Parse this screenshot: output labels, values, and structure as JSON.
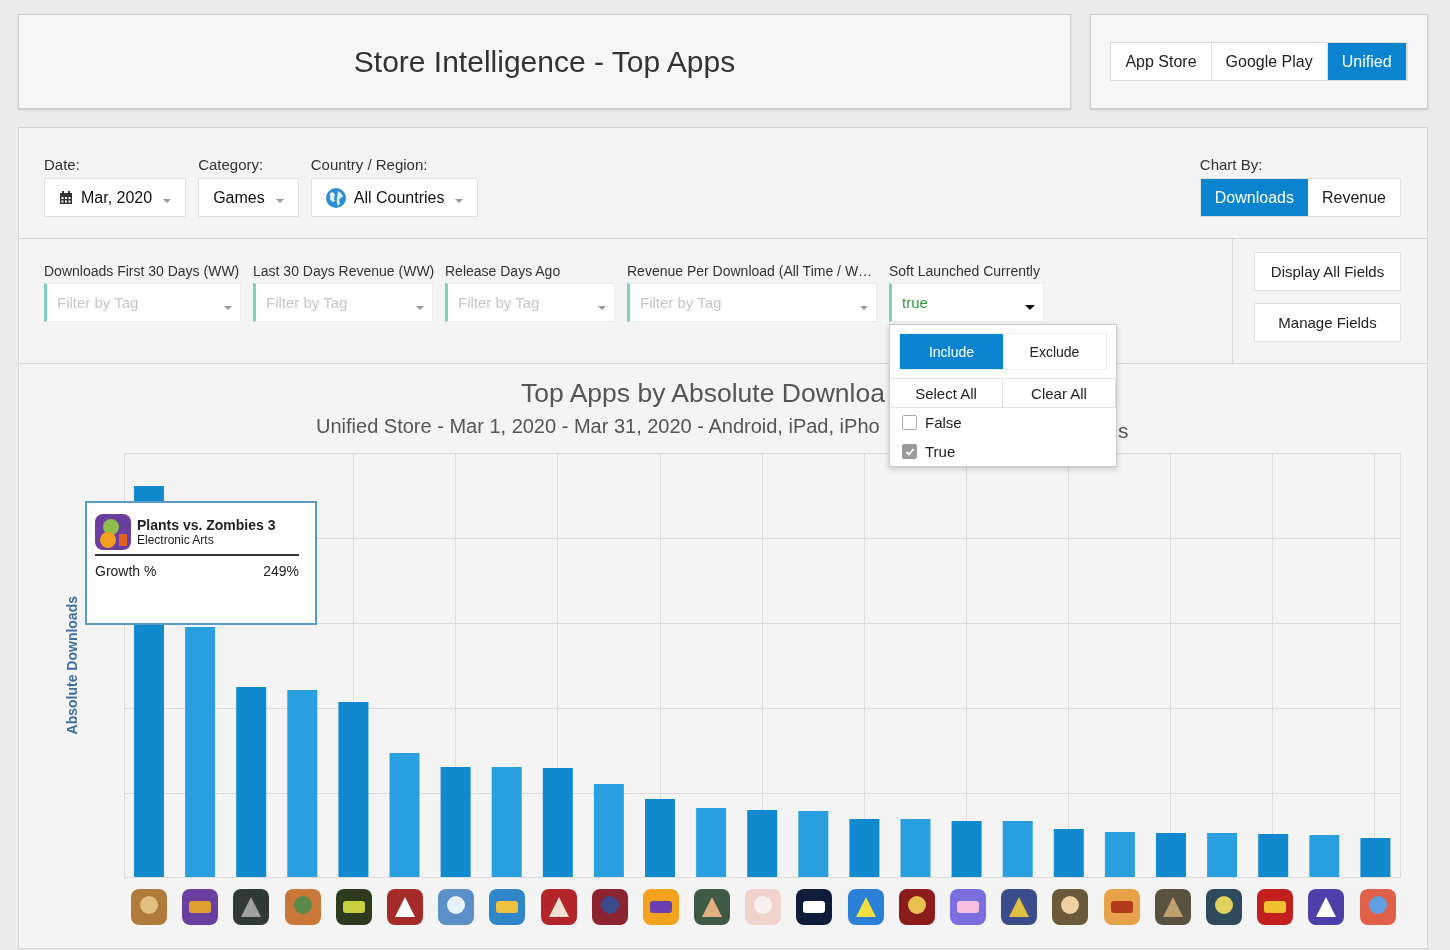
{
  "header": {
    "title": "Store Intelligence - Top Apps"
  },
  "store_tabs": [
    {
      "label": "App Store",
      "selected": false
    },
    {
      "label": "Google Play",
      "selected": false
    },
    {
      "label": "Unified",
      "selected": true
    }
  ],
  "filters": [
    {
      "kind": "date",
      "label": "Date:",
      "value": "Mar, 2020"
    },
    {
      "kind": "plain",
      "label": "Category:",
      "value": "Games"
    },
    {
      "kind": "country",
      "label": "Country / Region:",
      "value": "All Countries"
    }
  ],
  "chart_by": {
    "label": "Chart By:",
    "options": [
      {
        "label": "Downloads",
        "selected": true
      },
      {
        "label": "Revenue",
        "selected": false
      }
    ]
  },
  "field_filters": [
    {
      "label": "Downloads First 30 Days (WW)",
      "placeholder": "Filter by Tag",
      "open": false
    },
    {
      "label": "Last 30 Days Revenue (WW)",
      "placeholder": "Filter by Tag",
      "open": false
    },
    {
      "label": "Release Days Ago",
      "placeholder": "Filter by Tag",
      "open": false
    },
    {
      "label": "Revenue Per Download (All Time / W…",
      "placeholder": "Filter by Tag",
      "open": false
    },
    {
      "label": "Soft Launched Currently",
      "value": "true",
      "open": true
    }
  ],
  "dropdown": {
    "modes": [
      {
        "label": "Include",
        "selected": true
      },
      {
        "label": "Exclude",
        "selected": false
      }
    ],
    "actions": [
      "Select All",
      "Clear All"
    ],
    "options": [
      {
        "label": "False",
        "checked": false
      },
      {
        "label": "True",
        "checked": true
      }
    ]
  },
  "side_buttons": [
    "Display All Fields",
    "Manage Fields"
  ],
  "chart": {
    "title": "Top Apps by Absolute Downloa",
    "subtitle": "Unified Store - Mar 1, 2020 - Mar 31, 2020 - Android, iPad, iPho",
    "subtitle_tail": "s",
    "ylabel": "Absolute Downloads"
  },
  "tooltip": {
    "app": "Plants vs. Zombies 3",
    "publisher": "Electronic Arts",
    "metric": "Growth %",
    "value": "249%"
  }
}
